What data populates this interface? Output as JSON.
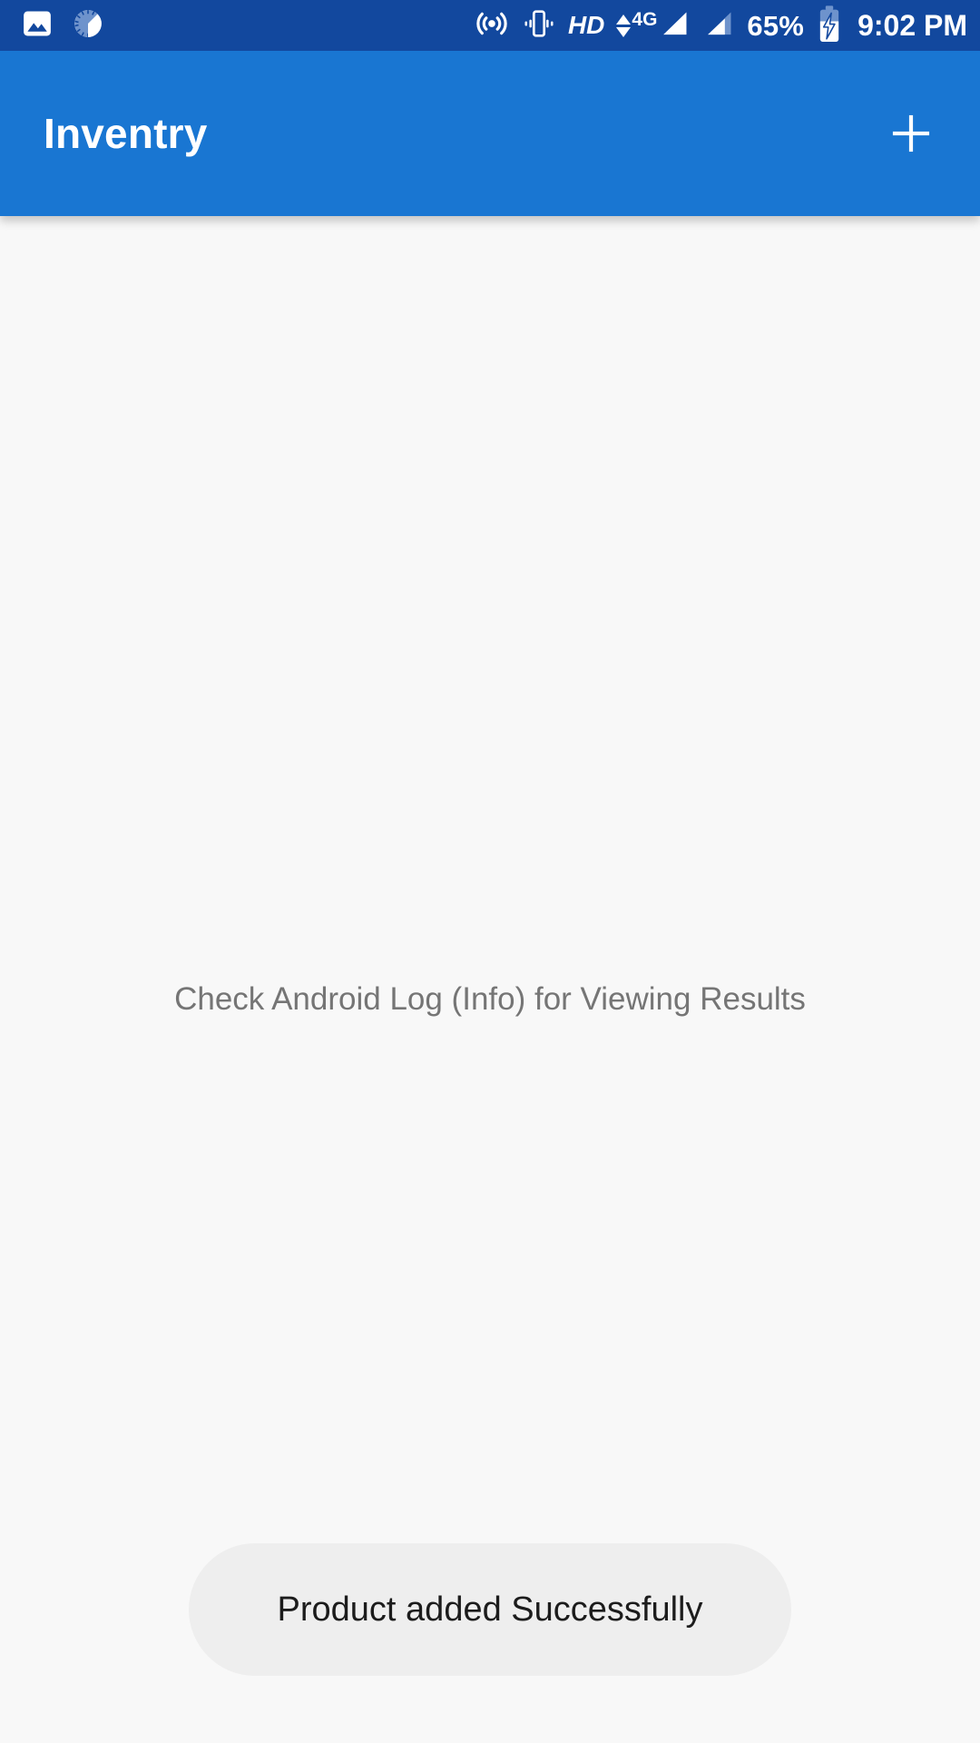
{
  "status_bar": {
    "background_color": "#12489e",
    "foreground_color": "#ffffff",
    "left_icons": [
      {
        "name": "photo-icon",
        "label": "Screenshot saved"
      },
      {
        "name": "sync-progress-icon",
        "label": "Syncing"
      }
    ],
    "right_icons": [
      {
        "name": "hotspot-icon",
        "label": "Hotspot active"
      },
      {
        "name": "vibrate-icon",
        "label": "Vibrate mode"
      }
    ],
    "hd_label": "HD",
    "network_type": "4G",
    "battery_percent": "65%",
    "battery_charging": true,
    "signal_bars": 2,
    "time": "9:02 PM"
  },
  "app_bar": {
    "title": "Inventry",
    "background_color": "#1976d2",
    "title_color": "#ffffff",
    "add_button_label": "+"
  },
  "main": {
    "background_color": "#f8f8f8",
    "message": "Check Android Log (Info) for Viewing Results",
    "message_color": "#757575"
  },
  "toast": {
    "message": "Product added Successfully",
    "background_color": "#eeeeee",
    "text_color": "#1c1c1c"
  }
}
